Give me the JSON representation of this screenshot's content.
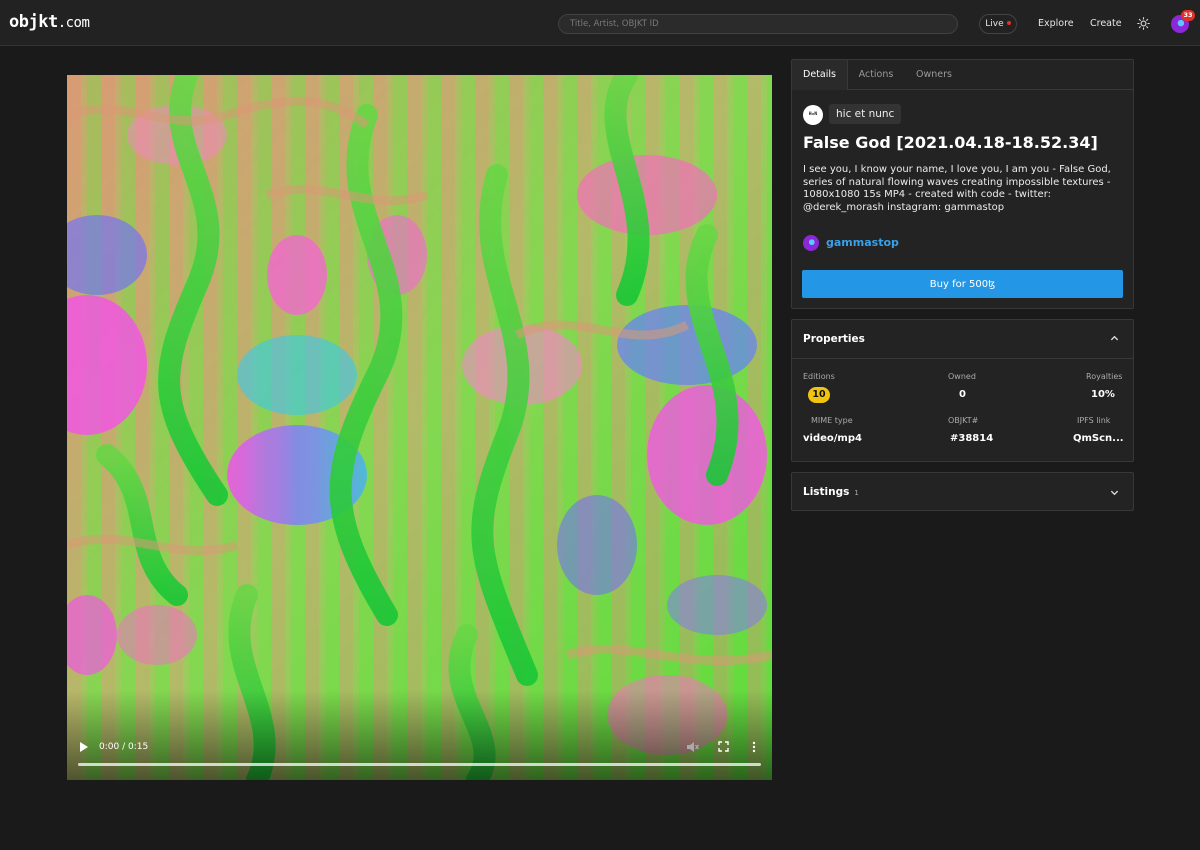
{
  "header": {
    "logo_main": "objkt",
    "logo_suffix": ".com",
    "search_placeholder": "Title, Artist, OBJKT ID",
    "live_label": "Live",
    "nav": {
      "explore": "Explore",
      "create": "Create"
    },
    "notification_count": "33"
  },
  "player": {
    "time": "0:00 / 0:15"
  },
  "details": {
    "tabs": [
      {
        "label": "Details"
      },
      {
        "label": "Actions"
      },
      {
        "label": "Owners"
      }
    ],
    "collection_icon_text": "H=N",
    "collection": "hic et nunc",
    "title": "False God [2021.04.18-18.52.34]",
    "description": "I see you, I know your name, I love you, I am you - False God, series of natural flowing waves creating impossible textures - 1080x1080 15s MP4 - created with code - twitter: @derek_morash instagram: gammastop",
    "artist": "gammastop",
    "buy_label": "Buy for 500ꜩ"
  },
  "properties": {
    "heading": "Properties",
    "editions_label": "Editions",
    "editions_value": "10",
    "owned_label": "Owned",
    "owned_value": "0",
    "royalties_label": "Royalties",
    "royalties_value": "10%",
    "mime_label": "MIME type",
    "mime_value": "video/mp4",
    "objkt_label": "OBJKT#",
    "objkt_value": "#38814",
    "ipfs_label": "IPFS link",
    "ipfs_value": "QmScn..."
  },
  "listings": {
    "heading": "Listings",
    "count": "1"
  },
  "colors": {
    "accent": "#2496e6",
    "artist_link": "#3aa0e8",
    "editions_badge": "#f1c40f",
    "live_dot": "#e0302a"
  }
}
